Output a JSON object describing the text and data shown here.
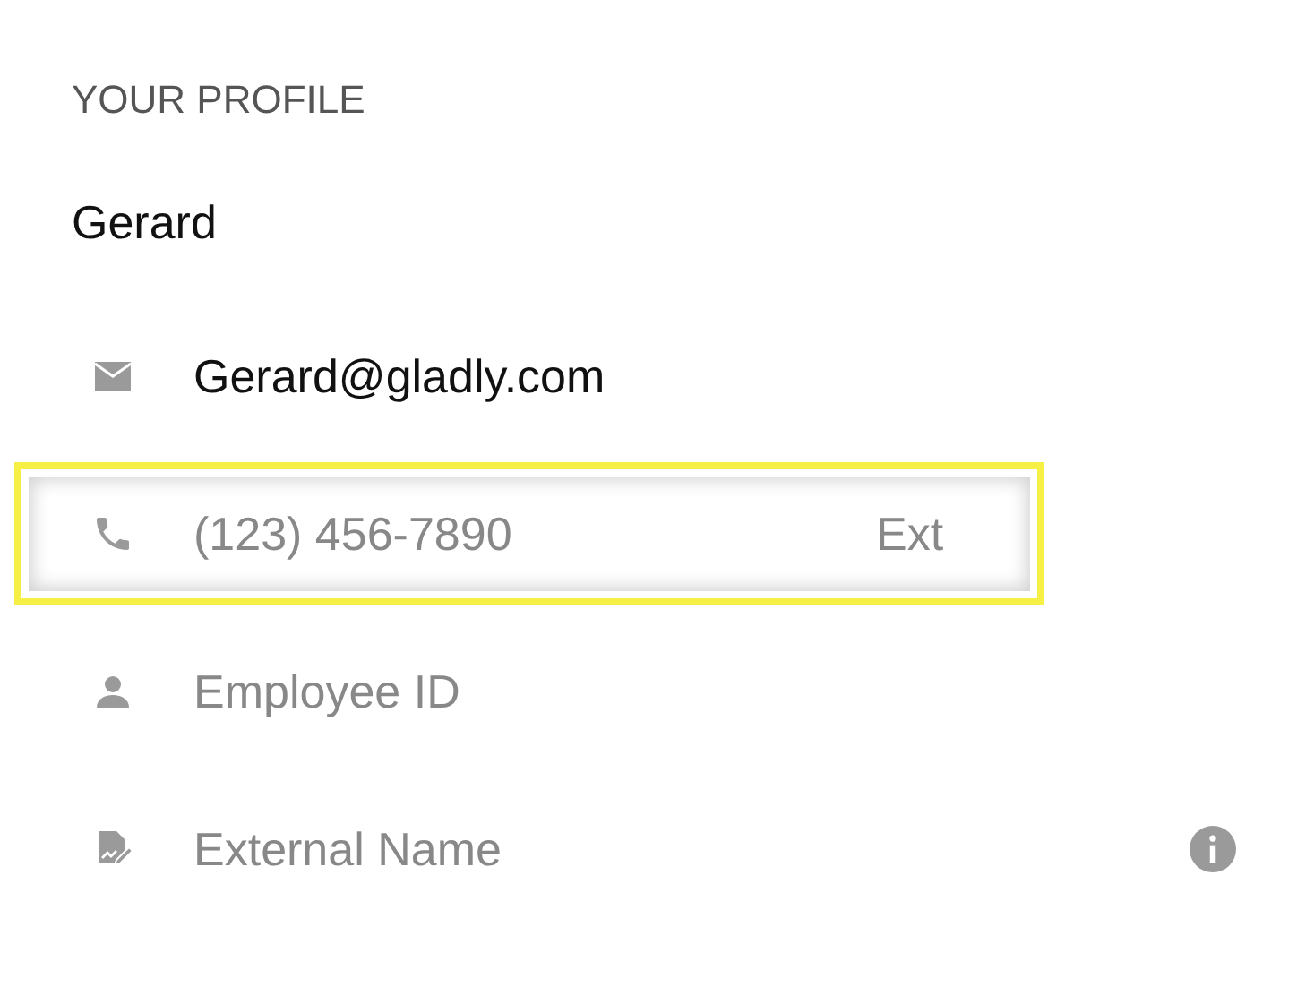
{
  "section_title": "YOUR PROFILE",
  "name": "Gerard",
  "fields": [
    {
      "kind": "email",
      "value": "Gerard@gladly.com",
      "highlighted": false
    },
    {
      "kind": "phone",
      "placeholder": "(123) 456-7890",
      "extension_placeholder": "Ext",
      "highlighted": true
    },
    {
      "kind": "employee_id",
      "placeholder": "Employee ID",
      "highlighted": false
    },
    {
      "kind": "external_name",
      "placeholder": "External Name",
      "info": true,
      "highlighted": false
    }
  ]
}
